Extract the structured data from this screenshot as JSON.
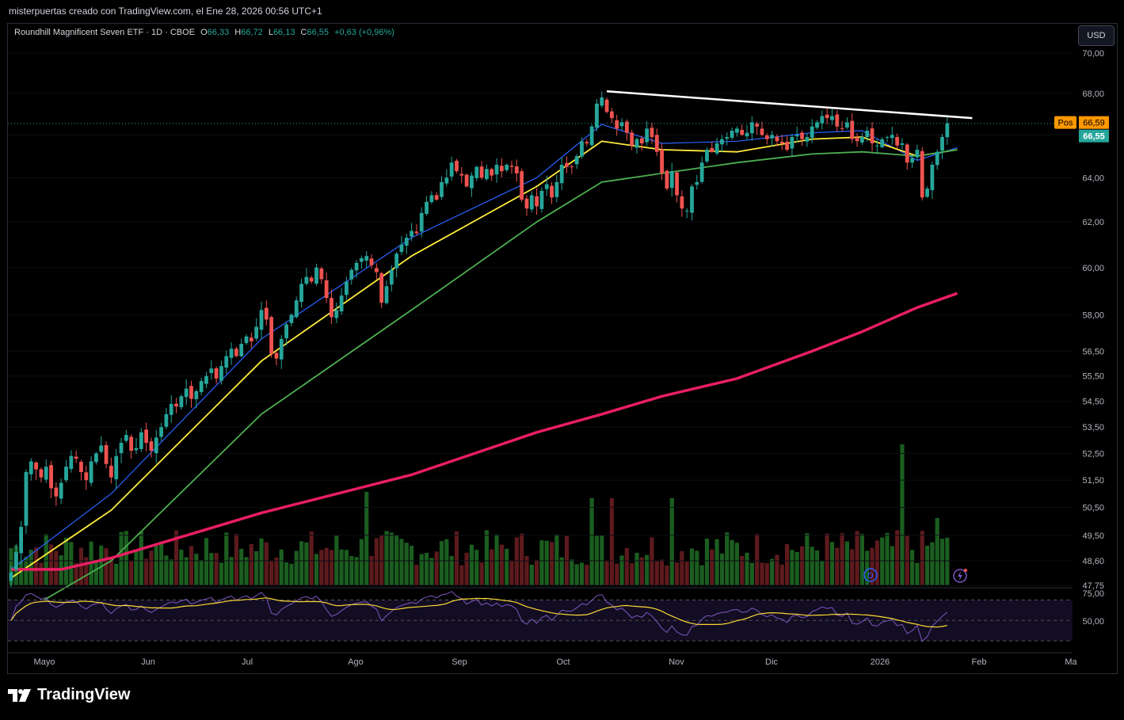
{
  "header": {
    "attribution": "misterpuertas creado con TradingView.com, el Ene 28, 2026 00:56 UTC+1"
  },
  "legend": {
    "symbol": "Roundhill Magnificent Seven ETF · 1D · CBOE",
    "open_label": "O",
    "open": "66,33",
    "high_label": "H",
    "high": "66,72",
    "low_label": "L",
    "low": "66,13",
    "close_label": "C",
    "close": "66,55",
    "change": "+0,63 (+0,96%)"
  },
  "currency_button": "USD",
  "brand": "TradingView",
  "colors": {
    "up": "#26a69a",
    "down": "#ef5350",
    "ema_fast": "#2962ff",
    "ema_mid": "#ffeb3b",
    "ema_slow": "#4caf50",
    "ema_long": "#e91e63",
    "trendline": "#ffffff",
    "pos_tag": "#ff9800",
    "rsi": "#7e57c2",
    "rsi_ma": "#fdd835"
  },
  "chart_data": {
    "type": "candlestick",
    "y_scale": "log",
    "ylim": [
      47.75,
      71.0
    ],
    "y_ticks": [
      "70,00",
      "68,00",
      "66,00",
      "64,00",
      "62,00",
      "60,00",
      "58,00",
      "56,50",
      "55,50",
      "54,50",
      "53,50",
      "52,50",
      "51,50",
      "50,50",
      "49,50",
      "48,60",
      "47,75"
    ],
    "x_ticks": [
      "Mayo",
      "Jun",
      "Jul",
      "Ago",
      "Sep",
      "Oct",
      "Nov",
      "Dic",
      "2026",
      "Feb",
      "Ma"
    ],
    "price_tags": [
      {
        "label": "Pos",
        "value": "66,59"
      },
      {
        "value": "66,55"
      }
    ],
    "closes": [
      48.2,
      48.9,
      49.8,
      51.8,
      52.2,
      51.9,
      51.6,
      52.0,
      51.2,
      50.9,
      51.4,
      52.0,
      52.4,
      52.3,
      51.8,
      51.5,
      52.2,
      52.5,
      52.8,
      52.1,
      51.6,
      52.4,
      52.9,
      53.2,
      52.6,
      52.7,
      53.3,
      52.9,
      52.6,
      53.1,
      53.5,
      54.0,
      54.4,
      54.3,
      54.7,
      55.0,
      54.6,
      54.9,
      55.3,
      55.5,
      55.8,
      55.4,
      55.9,
      56.3,
      56.6,
      56.3,
      56.8,
      57.1,
      56.9,
      57.5,
      58.2,
      57.8,
      56.4,
      56.2,
      57.0,
      57.6,
      58.0,
      58.6,
      59.3,
      59.6,
      59.4,
      60.0,
      59.5,
      58.7,
      57.9,
      58.2,
      58.8,
      59.4,
      59.9,
      60.2,
      60.4,
      60.5,
      60.1,
      59.8,
      58.5,
      59.2,
      59.9,
      60.6,
      61.0,
      61.3,
      61.6,
      61.5,
      62.4,
      62.9,
      63.2,
      63.0,
      63.8,
      64.0,
      64.7,
      64.3,
      64.1,
      63.6,
      64.1,
      64.5,
      64.0,
      64.4,
      64.1,
      64.6,
      64.3,
      64.6,
      64.5,
      64.2,
      63.0,
      62.6,
      63.2,
      62.7,
      63.4,
      63.7,
      63.1,
      63.8,
      64.6,
      64.5,
      64.5,
      65.0,
      65.7,
      65.6,
      66.4,
      67.5,
      67.8,
      67.1,
      66.8,
      66.3,
      66.6,
      66.1,
      65.5,
      65.8,
      65.6,
      66.3,
      65.9,
      65.2,
      64.2,
      63.5,
      64.3,
      63.2,
      62.6,
      62.5,
      63.6,
      63.8,
      64.7,
      65.3,
      65.2,
      65.6,
      65.8,
      65.9,
      66.2,
      66.3,
      66.0,
      66.1,
      66.6,
      66.4,
      66.0,
      65.8,
      66.0,
      65.7,
      65.6,
      65.3,
      65.9,
      66.0,
      65.8,
      65.9,
      66.4,
      66.6,
      66.9,
      66.8,
      66.9,
      66.4,
      66.3,
      66.6,
      65.8,
      65.7,
      65.9,
      66.2,
      65.6,
      65.5,
      65.8,
      65.9,
      66.0,
      65.5,
      65.6,
      64.7,
      64.9,
      65.3,
      63.1,
      63.5,
      64.6,
      65.2,
      65.9,
      66.55
    ],
    "series": [
      {
        "name": "EMA fast",
        "points": [
          [
            0,
            48.3
          ],
          [
            20,
            51.0
          ],
          [
            50,
            57.0
          ],
          [
            80,
            61.3
          ],
          [
            105,
            64.0
          ],
          [
            118,
            66.5
          ],
          [
            130,
            65.6
          ],
          [
            145,
            65.7
          ],
          [
            160,
            66.1
          ],
          [
            170,
            66.2
          ],
          [
            181,
            64.8
          ],
          [
            189,
            65.4
          ]
        ]
      },
      {
        "name": "EMA mid",
        "points": [
          [
            0,
            48.0
          ],
          [
            20,
            50.4
          ],
          [
            50,
            56.1
          ],
          [
            80,
            60.5
          ],
          [
            105,
            63.6
          ],
          [
            118,
            65.7
          ],
          [
            130,
            65.3
          ],
          [
            145,
            65.2
          ],
          [
            160,
            65.8
          ],
          [
            170,
            65.9
          ],
          [
            181,
            65.0
          ],
          [
            189,
            65.3
          ]
        ]
      },
      {
        "name": "EMA slow",
        "points": [
          [
            0,
            46.6
          ],
          [
            20,
            48.6
          ],
          [
            50,
            54.0
          ],
          [
            80,
            58.2
          ],
          [
            105,
            62.0
          ],
          [
            118,
            63.8
          ],
          [
            130,
            64.2
          ],
          [
            145,
            64.7
          ],
          [
            160,
            65.1
          ],
          [
            170,
            65.2
          ],
          [
            181,
            65.0
          ],
          [
            189,
            65.3
          ]
        ]
      },
      {
        "name": "EMA long",
        "points": [
          [
            0,
            48.3
          ],
          [
            10,
            48.3
          ],
          [
            20,
            48.7
          ],
          [
            50,
            50.3
          ],
          [
            80,
            51.7
          ],
          [
            105,
            53.3
          ],
          [
            118,
            54.0
          ],
          [
            130,
            54.7
          ],
          [
            145,
            55.4
          ],
          [
            160,
            56.5
          ],
          [
            170,
            57.3
          ],
          [
            181,
            58.3
          ],
          [
            189,
            58.9
          ]
        ]
      }
    ],
    "trendline": [
      [
        119,
        68.1
      ],
      [
        192,
        66.8
      ]
    ],
    "rsi": {
      "levels": [
        "75,00",
        "50,00"
      ],
      "ylim": [
        20,
        82
      ]
    }
  }
}
